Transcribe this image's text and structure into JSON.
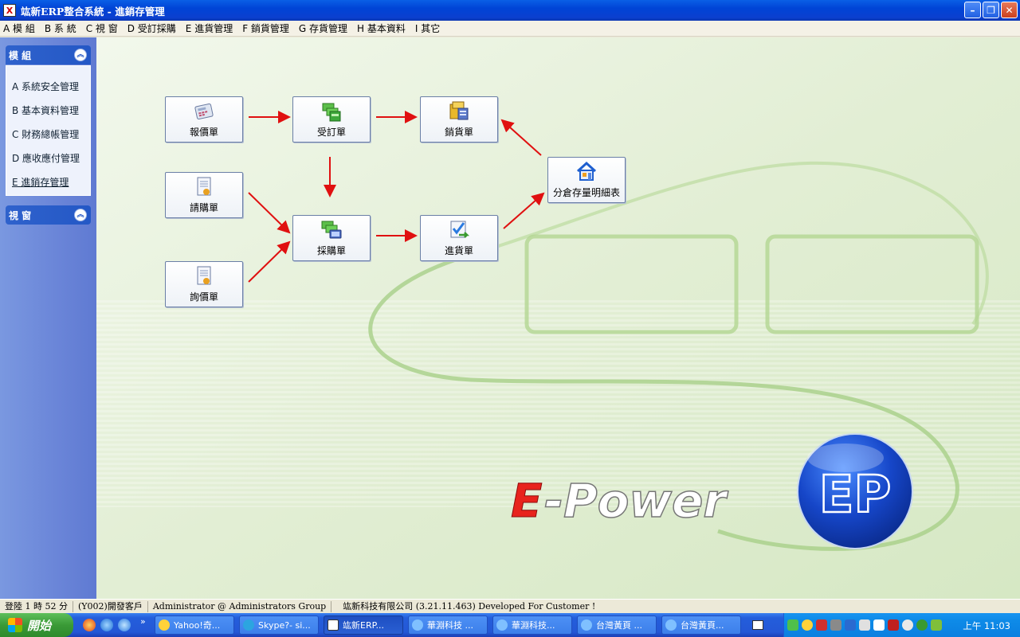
{
  "window": {
    "title": "竑新ERP整合系統 - 進銷存管理",
    "app_icon": "X"
  },
  "menu": [
    "A 模 組",
    "B 系 統",
    "C 視 窗",
    "D 受訂採購",
    "E 進貨管理",
    "F 銷貨管理",
    "G 存貨管理",
    "H 基本資料",
    "I 其它"
  ],
  "sidebar": {
    "modules_title": "模 組",
    "modules": [
      "A 系統安全管理",
      "B 基本資料管理",
      "C 財務總帳管理",
      "D 應收應付管理",
      "E 進銷存管理"
    ],
    "window_title": "視 窗"
  },
  "flow": {
    "quote": "報價單",
    "order": "受訂單",
    "sales": "銷貨單",
    "requisition": "請購單",
    "purchase": "採購單",
    "receipt": "進貨單",
    "inquiry": "詢價單",
    "stock": "分倉存量明細表"
  },
  "branding": {
    "e": "E",
    "power": "-Power",
    "badge": "EP"
  },
  "status": {
    "login_time": "登陸 1 時 52 分",
    "client": "(Y002)開發客戶",
    "user": "Administrator @ Administrators Group",
    "company": "竑新科技有限公司 (3.21.11.463) Developed For Customer !"
  },
  "taskbar": {
    "start": "開始",
    "tasks": [
      "Yahoo!奇...",
      "Skype?- si...",
      "竑新ERP...",
      "華淵科技 ...",
      "華淵科技...",
      "台灣黃頁 ...",
      "台灣黃頁..."
    ],
    "clock": "上午 11:03"
  },
  "colors": {
    "accent": "#2458c6",
    "arrow": "#e01010",
    "brand_red": "#e8231d",
    "brand_blue": "#1c49c8"
  }
}
